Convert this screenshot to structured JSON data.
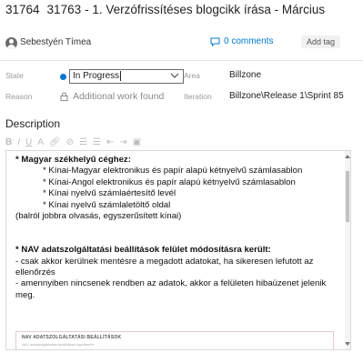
{
  "work_item": {
    "id": "31764",
    "parent_id": "31763",
    "title": "- 1. Verzófrissítéses blogcikk írása - Március"
  },
  "meta": {
    "assignee": "Sebestyén Tímea",
    "comments": "0 comments",
    "add_tag": "Add tag"
  },
  "fields": {
    "state_label": "State",
    "state_value": "In Progress",
    "area_label": "Area",
    "area_value": "Billzone",
    "reason_label": "Reason",
    "reason_value": "Additional work found",
    "iteration_label": "Iteration",
    "iteration_value": "Billzone\\Release 1\\Sprint 85"
  },
  "description": {
    "title": "Description",
    "toolbar": [
      "B",
      "I",
      "U",
      "A",
      "link",
      "clear",
      "bullets",
      "numbers",
      "outdent",
      "indent",
      "image"
    ],
    "lines": {
      "l1": "* Magyar székhelyű céghez:",
      "l2": "* Kínai-Magyar elektronikus és papír alapú kétnyelvű számlasablon",
      "l3": "* Kínai-Angol elektronikus és papír alapú kétnyelvű számlasablon",
      "l4": "* Kínai nyelvű számlaértesítő levél",
      "l5": "* Kínai nyelvű számlaletöltő oldal",
      "l6": "(balról jobbra olvasás, egyszerűsített kínai)",
      "l7": "* NAV adatszolgáltatási beállítások felület módosításra került:",
      "l8": "- csak akkor kerülnek mentésre a megadott adatokat, ha sikeresen lefutott az ellenőrzés",
      "l9": "- amennyiben nincsenek rendben az adatok, akkor a felületen hibaüzenet jelenik meg."
    },
    "embed_title": "NAV ADATSZOLGÁLTATÁSI BEÁLLÍTÁSOK",
    "embed_subtitle": "NAV adatszolgáltatási beállításai rögzítésére"
  },
  "colors": {
    "accent": "#0078d4",
    "state_dot": "#0078d4"
  }
}
